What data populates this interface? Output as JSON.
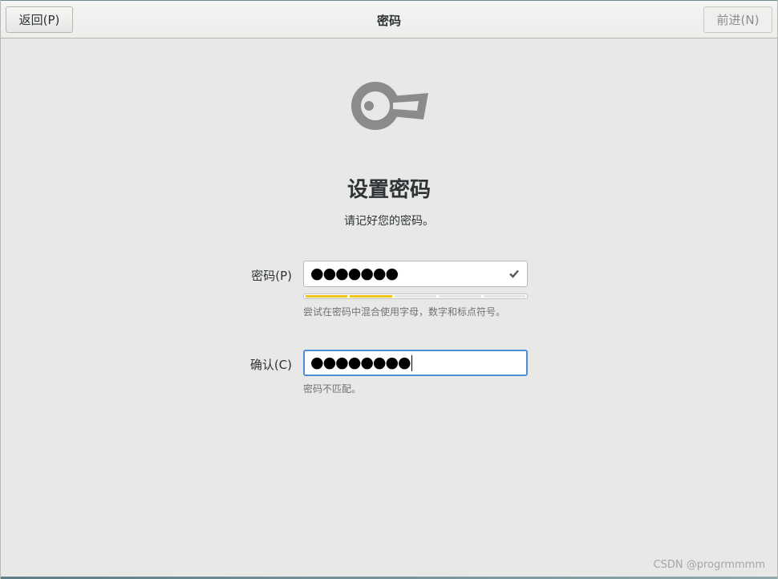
{
  "header": {
    "back_label": "返回(P)",
    "title": "密码",
    "next_label": "前进(N)"
  },
  "main": {
    "icon": "key-icon",
    "title": "设置密码",
    "subtitle": "请记好您的密码。",
    "password": {
      "label": "密码(P)",
      "value_masked": "●●●●●●●",
      "status_icon": "check-icon",
      "strength_level": 0.4,
      "hint": "尝试在密码中混合使用字母，数字和标点符号。"
    },
    "confirm": {
      "label": "确认(C)",
      "value_masked": "●●●●●●●●",
      "hint": "密码不匹配。"
    }
  },
  "watermark": "CSDN @progrmmmm",
  "colors": {
    "background": "#e8e8e7",
    "focus_border": "#4a90d9",
    "strength_fill": "#f0c419",
    "icon_gray": "#8a8c8c"
  }
}
